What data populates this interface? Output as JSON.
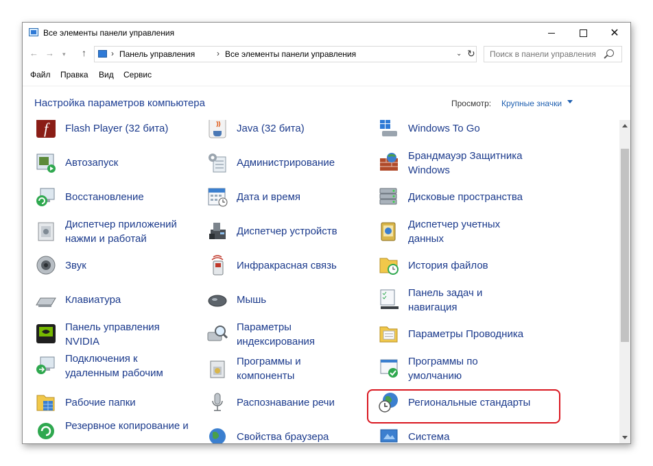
{
  "window": {
    "title": "Все элементы панели управления",
    "minimize_label": "",
    "maximize_label": "",
    "close_label": "✕"
  },
  "nav": {
    "back": "←",
    "forward": "→",
    "up": "↑",
    "breadcrumb": [
      "Панель управления",
      "Все элементы панели управления"
    ],
    "search_placeholder": "Поиск в панели управления"
  },
  "menu": [
    "Файл",
    "Правка",
    "Вид",
    "Сервис"
  ],
  "header": {
    "title": "Настройка параметров компьютера",
    "view_label": "Просмотр:",
    "view_value": "Крупные значки"
  },
  "items": [
    {
      "label": "Flash Player (32 бита)",
      "icon": "flash-icon"
    },
    {
      "label": "Java (32 бита)",
      "icon": "java-icon"
    },
    {
      "label": "Windows To Go",
      "icon": "windows-to-go-icon"
    },
    {
      "label": "Автозапуск",
      "icon": "autoplay-icon"
    },
    {
      "label": "Администрирование",
      "icon": "admin-tools-icon"
    },
    {
      "label": "Брандмауэр Защитника Windows",
      "icon": "firewall-icon"
    },
    {
      "label": "Восстановление",
      "icon": "recovery-icon"
    },
    {
      "label": "Дата и время",
      "icon": "calendar-icon"
    },
    {
      "label": "Дисковые пространства",
      "icon": "storage-spaces-icon"
    },
    {
      "label": "Диспетчер приложений нажми и работай",
      "icon": "app-manager-icon"
    },
    {
      "label": "Диспетчер устройств",
      "icon": "device-manager-icon"
    },
    {
      "label": "Диспетчер учетных данных",
      "icon": "credential-manager-icon"
    },
    {
      "label": "Звук",
      "icon": "speaker-icon"
    },
    {
      "label": "Инфракрасная связь",
      "icon": "infrared-icon"
    },
    {
      "label": "История файлов",
      "icon": "file-history-icon"
    },
    {
      "label": "Клавиатура",
      "icon": "keyboard-icon"
    },
    {
      "label": "Мышь",
      "icon": "mouse-icon"
    },
    {
      "label": "Панель задач и навигация",
      "icon": "taskbar-icon"
    },
    {
      "label": "Панель управления NVIDIA",
      "icon": "nvidia-icon"
    },
    {
      "label": "Параметры индексирования",
      "icon": "indexing-icon"
    },
    {
      "label": "Параметры Проводника",
      "icon": "folder-options-icon"
    },
    {
      "label": "Подключения к удаленным рабочим",
      "icon": "remote-desktop-icon"
    },
    {
      "label": "Программы и компоненты",
      "icon": "programs-icon"
    },
    {
      "label": "Программы по умолчанию",
      "icon": "default-programs-icon"
    },
    {
      "label": "Рабочие папки",
      "icon": "work-folders-icon"
    },
    {
      "label": "Распознавание речи",
      "icon": "microphone-icon"
    },
    {
      "label": "Региональные стандарты",
      "icon": "region-globe-icon"
    },
    {
      "label": "Резервное копирование и",
      "icon": "backup-icon"
    },
    {
      "label": "Свойства браузера",
      "icon": "internet-options-icon"
    },
    {
      "label": "Система",
      "icon": "system-icon"
    }
  ]
}
